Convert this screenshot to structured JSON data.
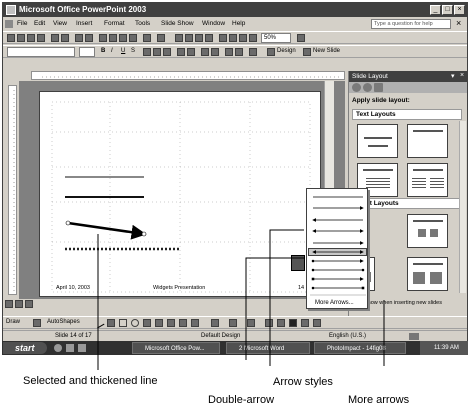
{
  "window": {
    "title": "Microsoft Office PowerPoint 2003",
    "caption_buttons": [
      "_",
      "□",
      "×"
    ]
  },
  "menu": {
    "items": [
      "File",
      "Edit",
      "View",
      "Insert",
      "Format",
      "Tools",
      "Slide Show",
      "Window",
      "Help"
    ],
    "ask_placeholder": "Type a question for help",
    "close_glyph": "×"
  },
  "toolbar": {
    "zoom": "50%",
    "font_style_buttons": [
      "B",
      "I",
      "U",
      "S"
    ],
    "design_label": "Design",
    "new_slide_label": "New Slide"
  },
  "slide": {
    "date_text": "April 10, 2003",
    "footer_text": "Widgets Presentation",
    "page_number": "14"
  },
  "task_pane": {
    "title": "Slide Layout",
    "apply_label": "Apply slide layout:",
    "text_layouts_label": "Text Layouts",
    "content_layouts_label": "Content Layouts",
    "content_layouts_visible": "ntent Layouts",
    "show_when_label": "Show when inserting new slides"
  },
  "arrow_popup": {
    "more_arrows_label": "More Arrows..."
  },
  "draw_toolbar": {
    "draw_label": "Draw",
    "autoshapes_label": "AutoShapes"
  },
  "status_bar": {
    "slide_info": "Slide 14 of 17",
    "design": "Default Design",
    "language": "English (U.S.)"
  },
  "taskbar": {
    "start_label": "start",
    "tasks": [
      "Microsoft Office Pow...",
      "2 Microsoft Word",
      "PhotoImpact - 14fig08"
    ],
    "clock": "11:39 AM"
  },
  "callouts": {
    "selected_line": "Selected and thickened line",
    "double_arrow": "Double-arrow",
    "arrow_styles": "Arrow styles",
    "more_arrows": "More arrows"
  }
}
